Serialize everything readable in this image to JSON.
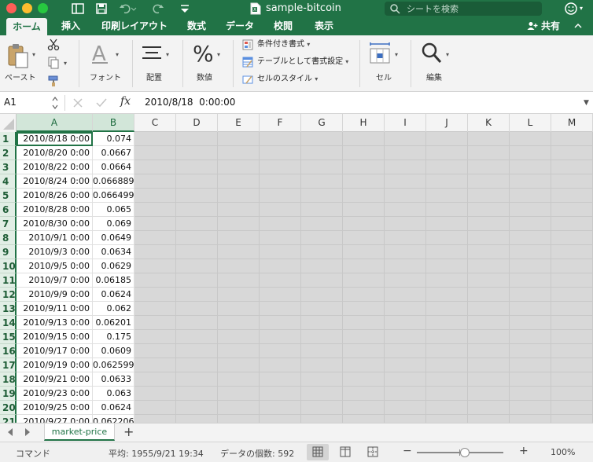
{
  "window": {
    "title": "sample-bitcoin",
    "search_placeholder": "シートを検索"
  },
  "ribbon_tabs": [
    "ホーム",
    "挿入",
    "印刷レイアウト",
    "数式",
    "データ",
    "校閲",
    "表示"
  ],
  "active_tab": "ホーム",
  "share_label": "共有",
  "ribbon": {
    "paste_label": "ペースト",
    "font_label": "フォント",
    "align_label": "配置",
    "number_label": "数値",
    "conditional_format": "条件付き書式",
    "format_as_table": "テーブルとして書式設定",
    "cell_styles": "セルのスタイル",
    "cells_label": "セル",
    "edit_label": "編集"
  },
  "formula_bar": {
    "name_box": "A1",
    "formula": "2010/8/18  0:00:00"
  },
  "columns": [
    "A",
    "B",
    "C",
    "D",
    "E",
    "F",
    "G",
    "H",
    "I",
    "J",
    "K",
    "L",
    "M"
  ],
  "rows": [
    {
      "n": "1",
      "a": "2010/8/18 0:00",
      "b": "0.074"
    },
    {
      "n": "2",
      "a": "2010/8/20 0:00",
      "b": "0.0667"
    },
    {
      "n": "3",
      "a": "2010/8/22 0:00",
      "b": "0.0664"
    },
    {
      "n": "4",
      "a": "2010/8/24 0:00",
      "b": "0.066889"
    },
    {
      "n": "5",
      "a": "2010/8/26 0:00",
      "b": "0.066499"
    },
    {
      "n": "6",
      "a": "2010/8/28 0:00",
      "b": "0.065"
    },
    {
      "n": "7",
      "a": "2010/8/30 0:00",
      "b": "0.069"
    },
    {
      "n": "8",
      "a": "2010/9/1 0:00",
      "b": "0.0649"
    },
    {
      "n": "9",
      "a": "2010/9/3 0:00",
      "b": "0.0634"
    },
    {
      "n": "10",
      "a": "2010/9/5 0:00",
      "b": "0.0629"
    },
    {
      "n": "11",
      "a": "2010/9/7 0:00",
      "b": "0.06185"
    },
    {
      "n": "12",
      "a": "2010/9/9 0:00",
      "b": "0.0624"
    },
    {
      "n": "13",
      "a": "2010/9/11 0:00",
      "b": "0.062"
    },
    {
      "n": "14",
      "a": "2010/9/13 0:00",
      "b": "0.06201"
    },
    {
      "n": "15",
      "a": "2010/9/15 0:00",
      "b": "0.175"
    },
    {
      "n": "16",
      "a": "2010/9/17 0:00",
      "b": "0.0609"
    },
    {
      "n": "17",
      "a": "2010/9/19 0:00",
      "b": "0.062599"
    },
    {
      "n": "18",
      "a": "2010/9/21 0:00",
      "b": "0.0633"
    },
    {
      "n": "19",
      "a": "2010/9/23 0:00",
      "b": "0.063"
    },
    {
      "n": "20",
      "a": "2010/9/25 0:00",
      "b": "0.0624"
    },
    {
      "n": "21",
      "a": "2010/9/27 0:00",
      "b": "0.062206"
    }
  ],
  "sheet_tab": "market-price",
  "status": {
    "mode": "コマンド",
    "average": "平均: 1955/9/21 19:34",
    "count": "データの個数: 592",
    "zoom": "100%",
    "zoom_fraction": 0.55
  },
  "colors": {
    "accent": "#217346"
  }
}
